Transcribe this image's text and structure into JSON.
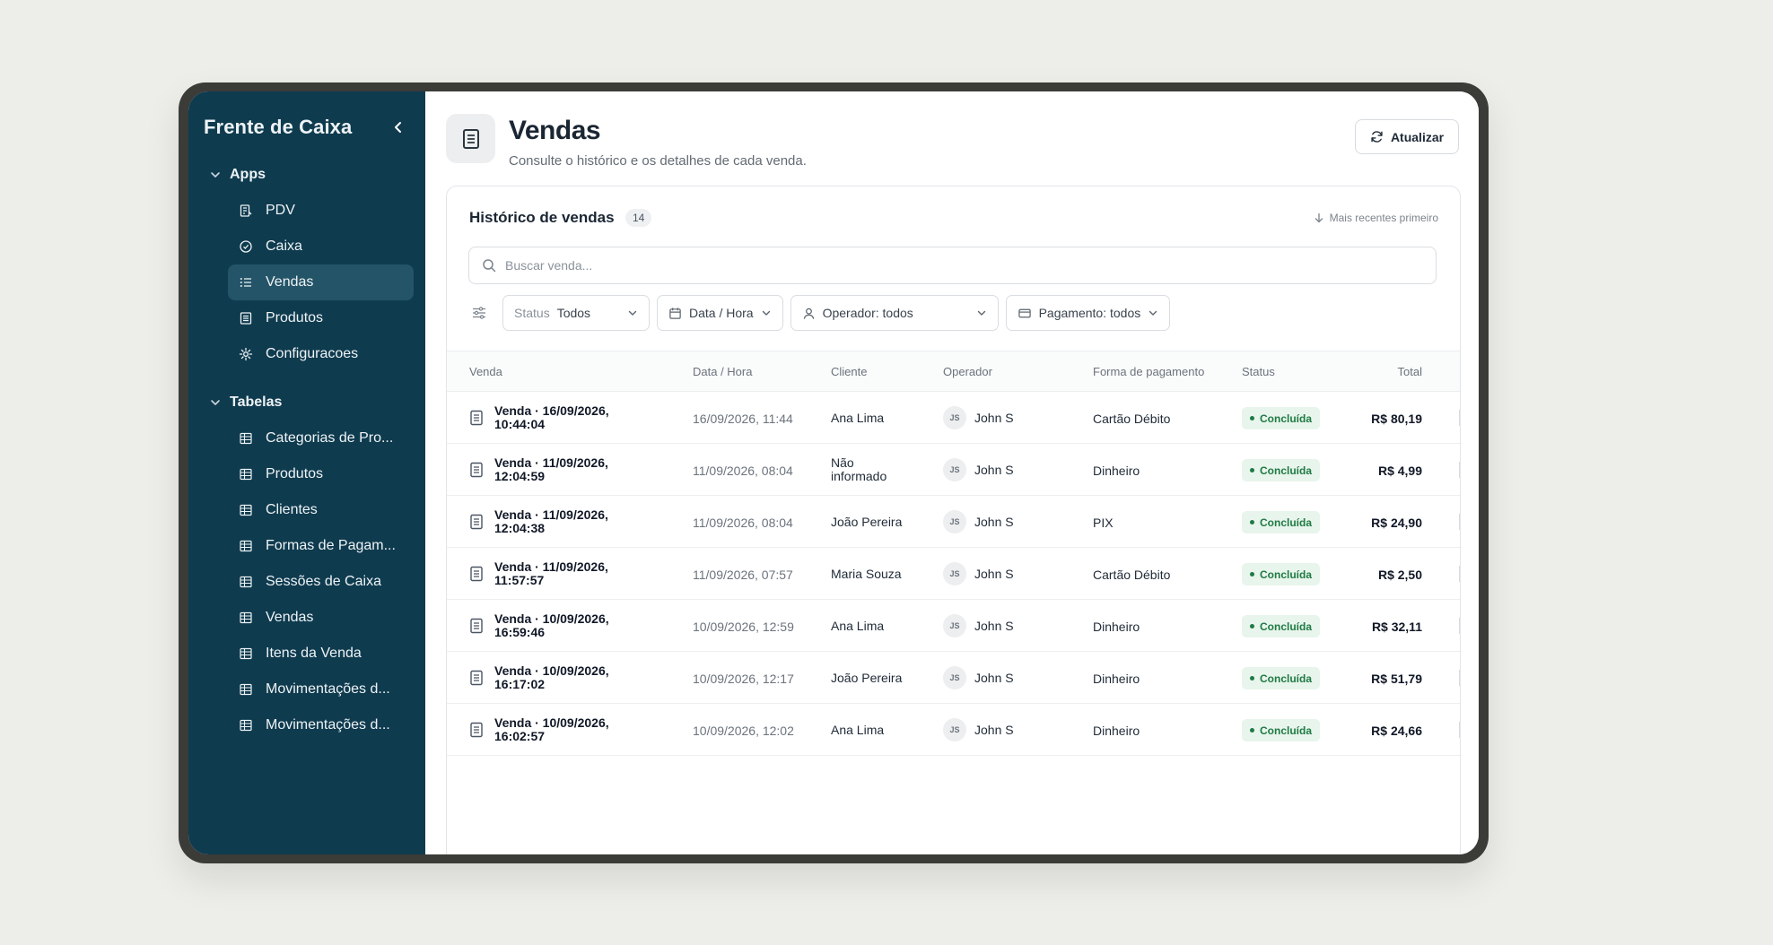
{
  "sidebar": {
    "title": "Frente de Caixa",
    "sections": [
      {
        "label": "Apps",
        "items": [
          "PDV",
          "Caixa",
          "Vendas",
          "Produtos",
          "Configuracoes"
        ]
      },
      {
        "label": "Tabelas",
        "items": [
          "Categorias de Pro...",
          "Produtos",
          "Clientes",
          "Formas de Pagam...",
          "Sessões de Caixa",
          "Vendas",
          "Itens da Venda",
          "Movimentações d...",
          "Movimentações d..."
        ]
      }
    ],
    "active_item": "Vendas"
  },
  "header": {
    "title": "Vendas",
    "subtitle": "Consulte o histórico e os detalhes de cada venda.",
    "refresh_label": "Atualizar"
  },
  "card": {
    "title": "Histórico de vendas",
    "count": "14",
    "sort_label": "Mais recentes primeiro",
    "search_placeholder": "Buscar venda...",
    "filters": {
      "status_label": "Status",
      "status_value": "Todos",
      "date_label": "Data / Hora",
      "operator_label": "Operador: todos",
      "payment_label": "Pagamento: todos"
    }
  },
  "table": {
    "columns": [
      "Venda",
      "Data / Hora",
      "Cliente",
      "Operador",
      "Forma de pagamento",
      "Status",
      "Total"
    ],
    "rows": [
      {
        "venda": "Venda · 16/09/2026, 10:44:04",
        "data": "16/09/2026, 11:44",
        "cliente": "Ana Lima",
        "operador": "John S",
        "iniciais": "JS",
        "pagamento": "Cartão Débito",
        "status": "Concluída",
        "total": "R$ 80,19"
      },
      {
        "venda": "Venda · 11/09/2026, 12:04:59",
        "data": "11/09/2026, 08:04",
        "cliente": "Não informado",
        "operador": "John S",
        "iniciais": "JS",
        "pagamento": "Dinheiro",
        "status": "Concluída",
        "total": "R$ 4,99"
      },
      {
        "venda": "Venda · 11/09/2026, 12:04:38",
        "data": "11/09/2026, 08:04",
        "cliente": "João Pereira",
        "operador": "John S",
        "iniciais": "JS",
        "pagamento": "PIX",
        "status": "Concluída",
        "total": "R$ 24,90"
      },
      {
        "venda": "Venda · 11/09/2026, 11:57:57",
        "data": "11/09/2026, 07:57",
        "cliente": "Maria Souza",
        "operador": "John S",
        "iniciais": "JS",
        "pagamento": "Cartão Débito",
        "status": "Concluída",
        "total": "R$ 2,50"
      },
      {
        "venda": "Venda · 10/09/2026, 16:59:46",
        "data": "10/09/2026, 12:59",
        "cliente": "Ana Lima",
        "operador": "John S",
        "iniciais": "JS",
        "pagamento": "Dinheiro",
        "status": "Concluída",
        "total": "R$ 32,11"
      },
      {
        "venda": "Venda · 10/09/2026, 16:17:02",
        "data": "10/09/2026, 12:17",
        "cliente": "João Pereira",
        "operador": "John S",
        "iniciais": "JS",
        "pagamento": "Dinheiro",
        "status": "Concluída",
        "total": "R$ 51,79"
      },
      {
        "venda": "Venda · 10/09/2026, 16:02:57",
        "data": "10/09/2026, 12:02",
        "cliente": "Ana Lima",
        "operador": "John S",
        "iniciais": "JS",
        "pagamento": "Dinheiro",
        "status": "Concluída",
        "total": "R$ 24,66"
      }
    ]
  },
  "icons": {
    "collapse": "chevron-left-icon",
    "section_toggle": "chevron-down-icon",
    "pdv": "receipt-icon",
    "caixa": "check-circle-icon",
    "vendas": "list-icon",
    "produtos": "document-icon",
    "configuracoes": "gear-icon",
    "table": "table-icon"
  },
  "colors": {
    "sidebar_bg": "#0f3b4f",
    "sidebar_active": "#245468",
    "status_bg": "#e8f5ec",
    "status_text": "#1f7a44"
  }
}
